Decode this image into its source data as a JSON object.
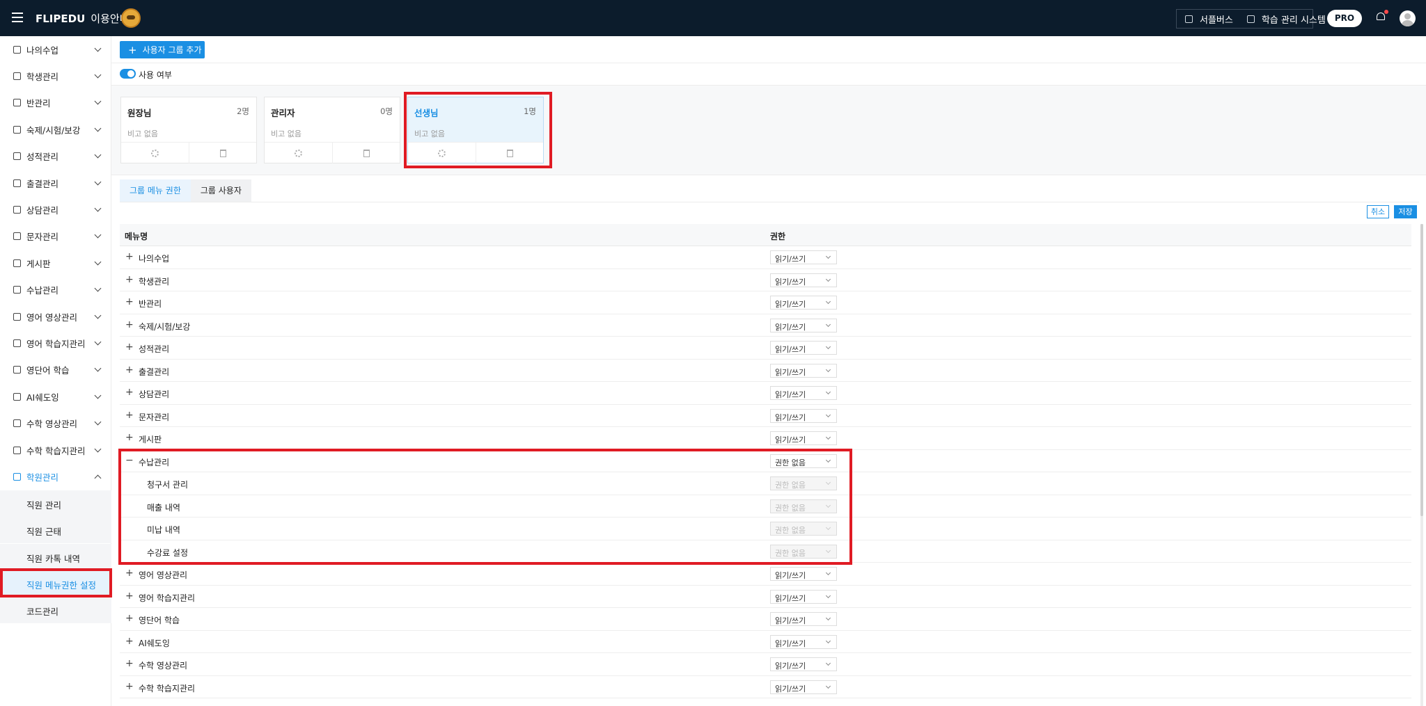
{
  "header": {
    "brand": "FLIPEDU",
    "guide": "이용안내",
    "links": [
      "서플버스",
      "학습 관리 시스템"
    ],
    "pro": "PRO"
  },
  "sidebar": {
    "items": [
      {
        "label": "나의수업",
        "icon": "home-icon"
      },
      {
        "label": "학생관리",
        "icon": "id-card-icon"
      },
      {
        "label": "반관리",
        "icon": "users-icon"
      },
      {
        "label": "숙제/시험/보강",
        "icon": "document-icon"
      },
      {
        "label": "성적관리",
        "icon": "chart-icon"
      },
      {
        "label": "출결관리",
        "icon": "calendar-icon"
      },
      {
        "label": "상담관리",
        "icon": "chat-icon"
      },
      {
        "label": "문자관리",
        "icon": "mail-icon"
      },
      {
        "label": "게시판",
        "icon": "board-icon"
      },
      {
        "label": "수납관리",
        "icon": "wallet-icon"
      },
      {
        "label": "영어 영상관리",
        "icon": "monitor-icon"
      },
      {
        "label": "영어 학습지관리",
        "icon": "worksheet-icon"
      },
      {
        "label": "영단어 학습",
        "icon": "book-icon"
      },
      {
        "label": "AI쉐도잉",
        "icon": "mic-icon"
      },
      {
        "label": "수학 영상관리",
        "icon": "monitor-icon"
      },
      {
        "label": "수학 학습지관리",
        "icon": "worksheet-icon"
      },
      {
        "label": "학원관리",
        "icon": "building-icon"
      }
    ],
    "sub_items": [
      "직원 관리",
      "직원 근태",
      "직원 카톡 내역",
      "직원 메뉴권한 설정",
      "코드관리"
    ]
  },
  "toolbar": {
    "add_group": "사용자 그룹 추가",
    "toggle_label": "사용 여부"
  },
  "groups": [
    {
      "name": "원장님",
      "count": "2명",
      "note": "비고 없음"
    },
    {
      "name": "관리자",
      "count": "0명",
      "note": "비고 없음"
    },
    {
      "name": "선생님",
      "count": "1명",
      "note": "비고 없음"
    }
  ],
  "tabs": [
    "그룹 메뉴 권한",
    "그룹 사용자"
  ],
  "actions": {
    "cancel": "취소",
    "save": "저장"
  },
  "table": {
    "columns": [
      "메뉴명",
      "권한"
    ],
    "rows": [
      {
        "name": "나의수업",
        "perm": "읽기/쓰기"
      },
      {
        "name": "학생관리",
        "perm": "읽기/쓰기"
      },
      {
        "name": "반관리",
        "perm": "읽기/쓰기"
      },
      {
        "name": "숙제/시험/보강",
        "perm": "읽기/쓰기"
      },
      {
        "name": "성적관리",
        "perm": "읽기/쓰기"
      },
      {
        "name": "출결관리",
        "perm": "읽기/쓰기"
      },
      {
        "name": "상담관리",
        "perm": "읽기/쓰기"
      },
      {
        "name": "문자관리",
        "perm": "읽기/쓰기"
      },
      {
        "name": "게시판",
        "perm": "읽기/쓰기"
      },
      {
        "name": "수납관리",
        "perm": "권한 없음"
      },
      {
        "name": "청구서 관리",
        "perm": "권한 없음"
      },
      {
        "name": "매출 내역",
        "perm": "권한 없음"
      },
      {
        "name": "미납 내역",
        "perm": "권한 없음"
      },
      {
        "name": "수강료 설정",
        "perm": "권한 없음"
      },
      {
        "name": "영어 영상관리",
        "perm": "읽기/쓰기"
      },
      {
        "name": "영어 학습지관리",
        "perm": "읽기/쓰기"
      },
      {
        "name": "영단어 학습",
        "perm": "읽기/쓰기"
      },
      {
        "name": "AI쉐도잉",
        "perm": "읽기/쓰기"
      },
      {
        "name": "수학 영상관리",
        "perm": "읽기/쓰기"
      },
      {
        "name": "수학 학습지관리",
        "perm": "읽기/쓰기"
      }
    ]
  },
  "colors": {
    "accent": "#1a8fe3",
    "header_bg": "#0c1c2c",
    "highlight": "#e01b24"
  }
}
